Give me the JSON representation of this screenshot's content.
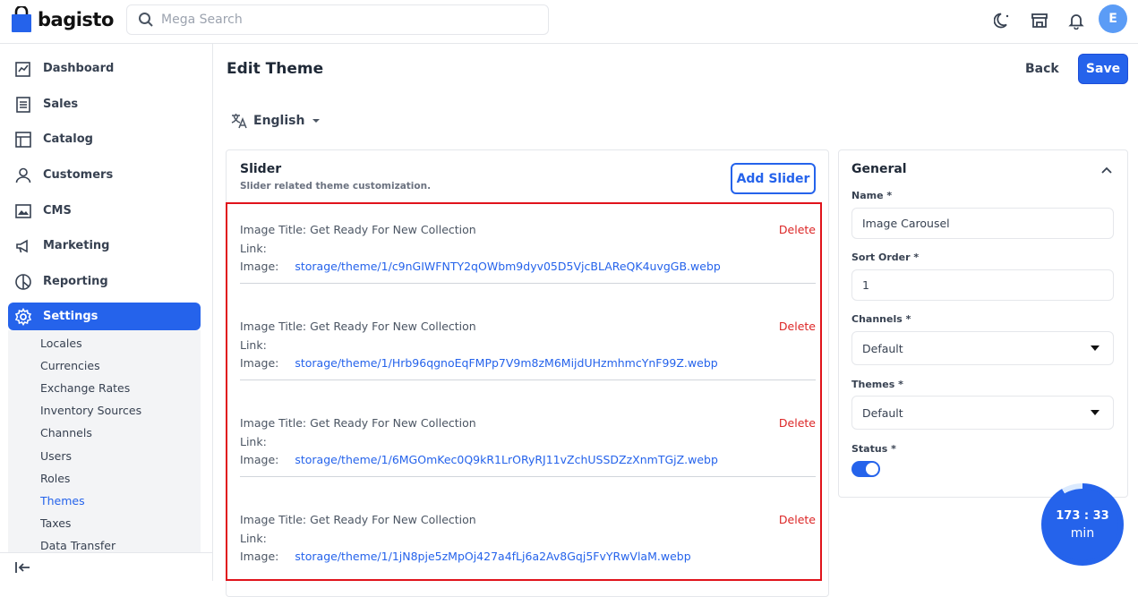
{
  "brand": {
    "name": "bagisto",
    "accent": "#2563eb"
  },
  "search": {
    "placeholder": "Mega Search"
  },
  "header_icons": [
    "dark-mode-icon",
    "store-icon",
    "notification-bell-icon"
  ],
  "user": {
    "initial": "E"
  },
  "sidebar": {
    "items": [
      {
        "label": "Dashboard",
        "icon": "dashboard-icon"
      },
      {
        "label": "Sales",
        "icon": "sales-icon"
      },
      {
        "label": "Catalog",
        "icon": "catalog-icon"
      },
      {
        "label": "Customers",
        "icon": "customers-icon"
      },
      {
        "label": "CMS",
        "icon": "cms-icon"
      },
      {
        "label": "Marketing",
        "icon": "marketing-icon"
      },
      {
        "label": "Reporting",
        "icon": "reporting-icon"
      },
      {
        "label": "Settings",
        "icon": "settings-icon",
        "active": true
      }
    ],
    "sub_items": [
      {
        "label": "Locales"
      },
      {
        "label": "Currencies"
      },
      {
        "label": "Exchange Rates"
      },
      {
        "label": "Inventory Sources"
      },
      {
        "label": "Channels"
      },
      {
        "label": "Users"
      },
      {
        "label": "Roles"
      },
      {
        "label": "Themes",
        "active": true
      },
      {
        "label": "Taxes"
      },
      {
        "label": "Data Transfer"
      }
    ]
  },
  "page": {
    "title": "Edit Theme",
    "back_label": "Back",
    "save_label": "Save",
    "locale": "English"
  },
  "slider_section": {
    "title": "Slider",
    "subtitle": "Slider related theme customization.",
    "add_label": "Add Slider",
    "slides": [
      {
        "title": "Image Title: Get Ready For New Collection",
        "link_label": "Link:",
        "image_label": "Image:",
        "image_path": "storage/theme/1/c9nGIWFNTY2qOWbm9dyv05D5VjcBLAReQK4uvgGB.webp",
        "delete_label": "Delete"
      },
      {
        "title": "Image Title: Get Ready For New Collection",
        "link_label": "Link:",
        "image_label": "Image:",
        "image_path": "storage/theme/1/Hrb96qgnoEqFMPp7V9m8zM6MijdUHzmhmcYnF99Z.webp",
        "delete_label": "Delete"
      },
      {
        "title": "Image Title: Get Ready For New Collection",
        "link_label": "Link:",
        "image_label": "Image:",
        "image_path": "storage/theme/1/6MGOmKec0Q9kR1LrORyRJ11vZchUSSDZzXnmTGjZ.webp",
        "delete_label": "Delete"
      },
      {
        "title": "Image Title: Get Ready For New Collection",
        "link_label": "Link:",
        "image_label": "Image:",
        "image_path": "storage/theme/1/1jN8pje5zMpOj427a4fLj6a2Av8Gqj5FvYRwVlaM.webp",
        "delete_label": "Delete"
      }
    ]
  },
  "general": {
    "title": "General",
    "name_label": "Name *",
    "name_value": "Image Carousel",
    "sort_label": "Sort Order *",
    "sort_value": "1",
    "channels_label": "Channels *",
    "channels_value": "Default",
    "themes_label": "Themes *",
    "themes_value": "Default",
    "status_label": "Status *",
    "status_on": true
  },
  "timer": {
    "time": "173 : 33",
    "unit": "min"
  },
  "colors": {
    "highlight": "#e0131b",
    "delete": "#dc2626",
    "link": "#2563eb"
  }
}
